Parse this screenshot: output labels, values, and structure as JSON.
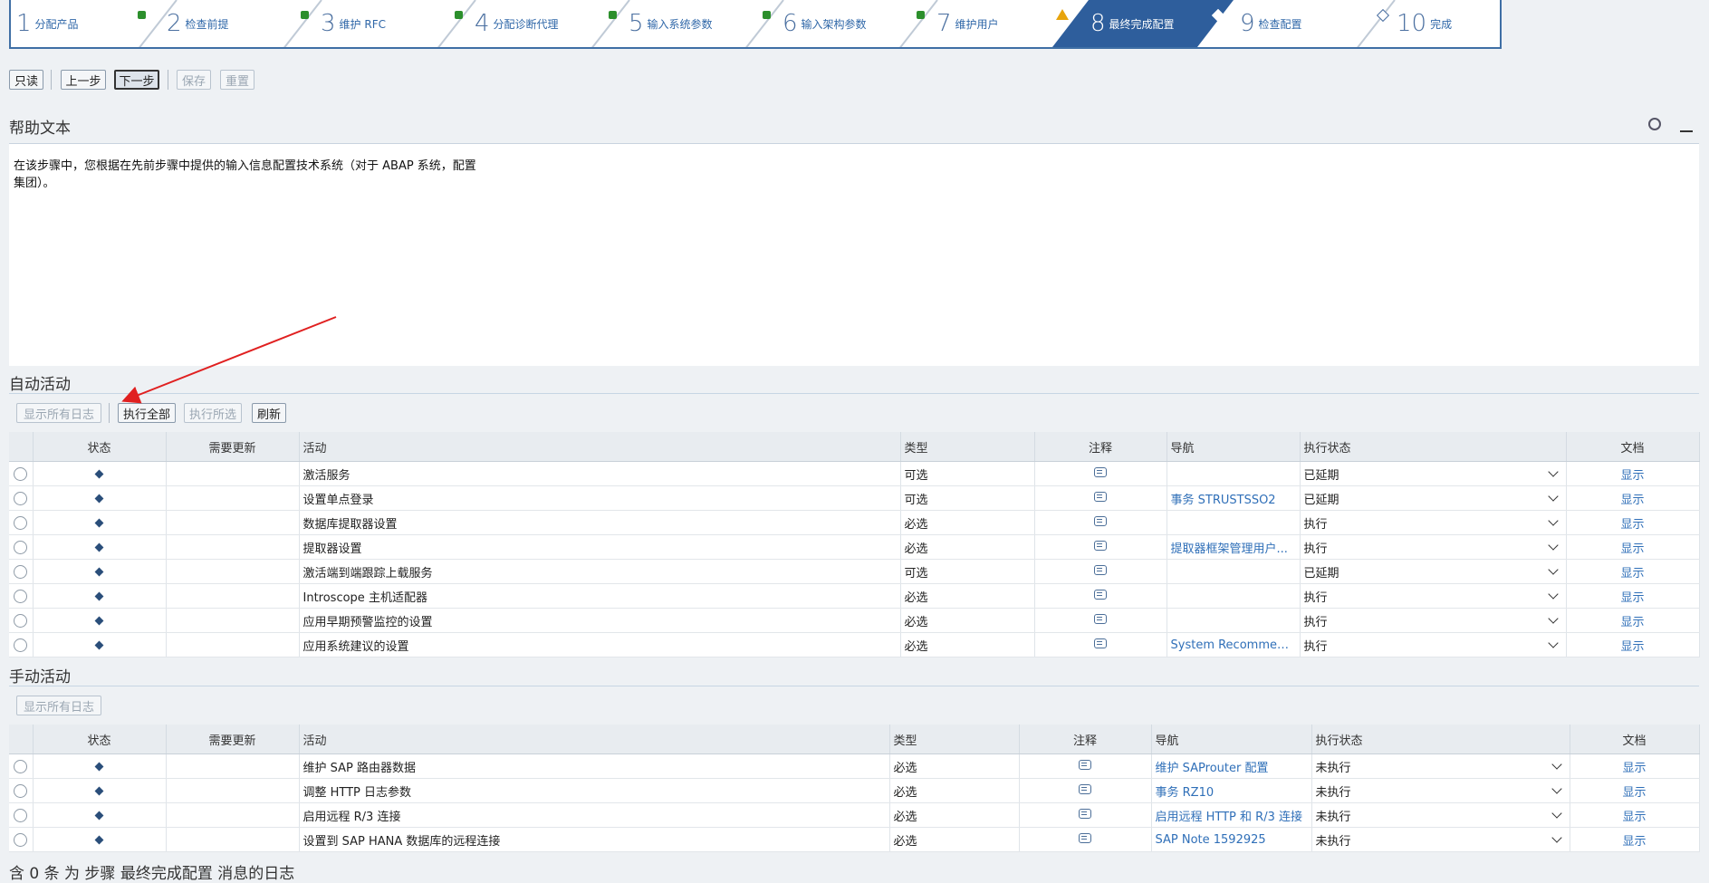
{
  "wizard": {
    "steps": [
      {
        "num": "1",
        "label": "分配产品",
        "status": "none"
      },
      {
        "num": "2",
        "label": "检查前提",
        "status": "done"
      },
      {
        "num": "3",
        "label": "维护 RFC",
        "status": "done"
      },
      {
        "num": "4",
        "label": "分配诊断代理",
        "status": "done"
      },
      {
        "num": "5",
        "label": "输入系统参数",
        "status": "done"
      },
      {
        "num": "6",
        "label": "输入架构参数",
        "status": "done"
      },
      {
        "num": "7",
        "label": "维护用户",
        "status": "done"
      },
      {
        "num": "8",
        "label": "最终完成配置",
        "status": "warn"
      },
      {
        "num": "9",
        "label": "检查配置",
        "status": "pending"
      },
      {
        "num": "10",
        "label": "完成",
        "status": "pending"
      }
    ]
  },
  "toolbar": {
    "readonly": "只读",
    "prev": "上一步",
    "next": "下一步",
    "save": "保存",
    "reset": "重置"
  },
  "help": {
    "title": "帮助文本",
    "text": "在该步骤中，您根据在先前步骤中提供的输入信息配置技术系统（对于 ABAP 系统，配置集团）。"
  },
  "auto": {
    "title": "自动活动",
    "buttons": {
      "show_logs": "显示所有日志",
      "exec_all": "执行全部",
      "exec_sel": "执行所选",
      "refresh": "刷新"
    },
    "columns": [
      "状态",
      "需要更新",
      "活动",
      "类型",
      "注释",
      "导航",
      "执行状态",
      "文档"
    ],
    "rows": [
      {
        "activity": "激活服务",
        "type": "可选",
        "nav": "",
        "exec": "已延期",
        "doc": "显示"
      },
      {
        "activity": "设置单点登录",
        "type": "可选",
        "nav": "事务 STRUSTSSO2",
        "exec": "已延期",
        "doc": "显示"
      },
      {
        "activity": "数据库提取器设置",
        "type": "必选",
        "nav": "",
        "exec": "执行",
        "doc": "显示"
      },
      {
        "activity": "提取器设置",
        "type": "必选",
        "nav": "提取器框架管理用户...",
        "exec": "执行",
        "doc": "显示"
      },
      {
        "activity": "激活端到端跟踪上载服务",
        "type": "可选",
        "nav": "",
        "exec": "已延期",
        "doc": "显示"
      },
      {
        "activity": "Introscope 主机适配器",
        "type": "必选",
        "nav": "",
        "exec": "执行",
        "doc": "显示"
      },
      {
        "activity": "应用早期预警监控的设置",
        "type": "必选",
        "nav": "",
        "exec": "执行",
        "doc": "显示"
      },
      {
        "activity": "应用系统建议的设置",
        "type": "必选",
        "nav": "System Recommen...",
        "exec": "执行",
        "doc": "显示"
      }
    ]
  },
  "manual": {
    "title": "手动活动",
    "buttons": {
      "show_logs": "显示所有日志"
    },
    "columns": [
      "状态",
      "需要更新",
      "活动",
      "类型",
      "注释",
      "导航",
      "执行状态",
      "文档"
    ],
    "rows": [
      {
        "activity": "维护 SAP 路由器数据",
        "type": "必选",
        "nav": "维护 SAProuter 配置",
        "exec": "未执行",
        "doc": "显示"
      },
      {
        "activity": "调整 HTTP 日志参数",
        "type": "必选",
        "nav": "事务 RZ10",
        "exec": "未执行",
        "doc": "显示"
      },
      {
        "activity": "启用远程 R/3 连接",
        "type": "必选",
        "nav": "启用远程 HTTP 和 R/3 连接",
        "exec": "未执行",
        "doc": "显示"
      },
      {
        "activity": "设置到 SAP HANA 数据库的远程连接",
        "type": "必选",
        "nav": "SAP Note 1592925",
        "exec": "未执行",
        "doc": "显示"
      }
    ]
  },
  "log": {
    "title": "含 0 条 为 步骤 最终完成配置 消息的日志"
  },
  "colors": {
    "accent": "#2e5e9c",
    "link": "#2f6fb8",
    "done": "#2c8f2c",
    "warn": "#e7a40d",
    "arrow": "#e02020"
  }
}
